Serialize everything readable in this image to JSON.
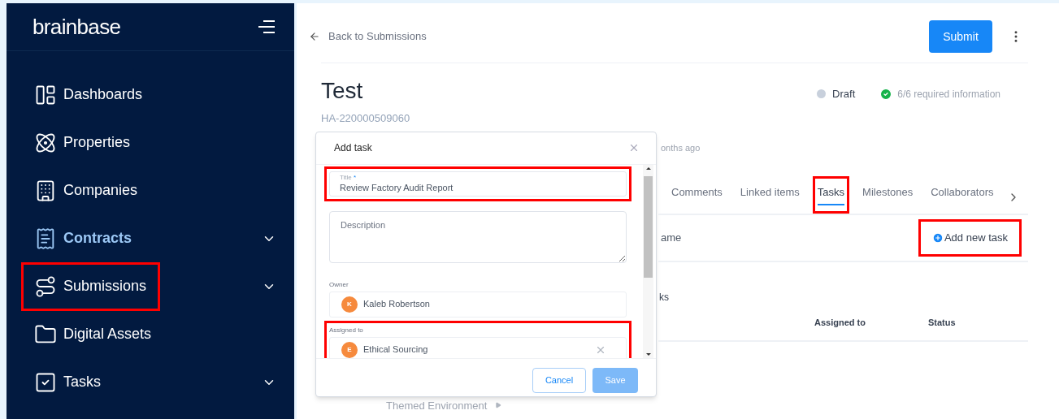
{
  "sidebar": {
    "logo": "brainbase",
    "items": [
      {
        "label": "Dashboards",
        "selected": false,
        "expandable": false,
        "highlighted": false
      },
      {
        "label": "Properties",
        "selected": false,
        "expandable": false,
        "highlighted": false
      },
      {
        "label": "Companies",
        "selected": false,
        "expandable": false,
        "highlighted": false
      },
      {
        "label": "Contracts",
        "selected": true,
        "expandable": true,
        "highlighted": false
      },
      {
        "label": "Submissions",
        "selected": false,
        "expandable": true,
        "highlighted": true
      },
      {
        "label": "Digital Assets",
        "selected": false,
        "expandable": false,
        "highlighted": false
      },
      {
        "label": "Tasks",
        "selected": false,
        "expandable": true,
        "highlighted": false
      }
    ]
  },
  "header": {
    "back_link": "Back to Submissions",
    "submit_button": "Submit",
    "title": "Test",
    "id": "HA-220000509060",
    "status": "Draft",
    "requirements": "6/6 required information"
  },
  "modal": {
    "title": "Add task",
    "fields": [
      {
        "kind": "text",
        "label": "Title",
        "required_mark": "*",
        "value": "Review Factory Audit Report",
        "highlighted": true
      },
      {
        "kind": "textarea",
        "placeholder": "Description",
        "highlighted": false
      },
      {
        "kind": "person",
        "label": "Owner",
        "avatar": "K",
        "value": "Kaleb Robertson",
        "clearable": false,
        "highlighted": false
      },
      {
        "kind": "person",
        "label": "Assigned to",
        "avatar": "E",
        "value": "Ethical Sourcing",
        "clearable": true,
        "highlighted": true
      }
    ],
    "buttons": {
      "cancel": "Cancel",
      "save": "Save",
      "save_disabled": true
    }
  },
  "below_modal": "Themed Environment",
  "detail": {
    "updated_fragment": "onths ago",
    "tabs": [
      {
        "label": "Comments",
        "selected": false,
        "highlighted": false
      },
      {
        "label": "Linked items",
        "selected": false,
        "highlighted": false
      },
      {
        "label": "Tasks",
        "selected": true,
        "highlighted": true
      },
      {
        "label": "Milestones",
        "selected": false,
        "highlighted": false
      },
      {
        "label": "Collaborators",
        "selected": false,
        "highlighted": false
      }
    ],
    "name_fragment": "ame",
    "add_task": {
      "label": "Add new task",
      "highlighted": true
    },
    "section_fragment": "ks",
    "table": {
      "columns": [
        "Assigned to",
        "Status"
      ]
    }
  }
}
